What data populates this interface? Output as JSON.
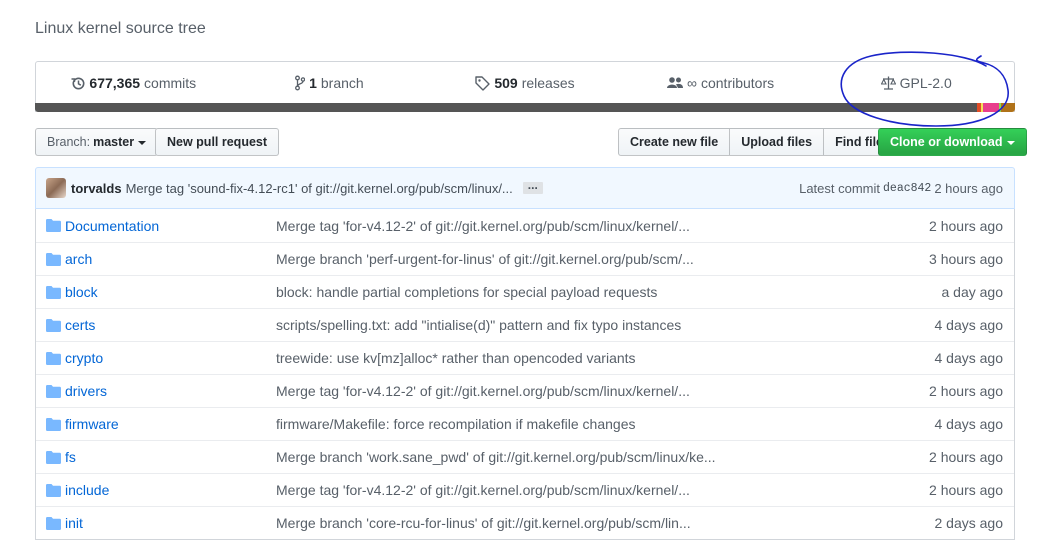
{
  "repo": {
    "description": "Linux kernel source tree"
  },
  "summary": {
    "commits": {
      "icon": "history-icon",
      "count": "677,365",
      "label": "commits"
    },
    "branch": {
      "icon": "git-branch-icon",
      "count": "1",
      "label": "branch"
    },
    "releases": {
      "icon": "tag-icon",
      "count": "509",
      "label": "releases"
    },
    "contributors": {
      "icon": "people-icon",
      "count": "∞",
      "label": "contributors"
    },
    "license": {
      "icon": "law-icon",
      "label": "GPL-2.0"
    }
  },
  "language_bar": [
    {
      "color": "#555555",
      "share": 0.961
    },
    {
      "color": "#e34c26",
      "share": 0.004
    },
    {
      "color": "#f1e05a",
      "share": 0.002
    },
    {
      "color": "#e83e8c",
      "share": 0.017
    },
    {
      "color": "#89e051",
      "share": 0.002
    },
    {
      "color": "#b07219",
      "share": 0.014
    }
  ],
  "toolbar": {
    "branch_prefix": "Branch:",
    "branch_name": "master",
    "new_pr": "New pull request",
    "create_file": "Create new file",
    "upload_files": "Upload files",
    "find_file": "Find file",
    "clone": "Clone or download"
  },
  "latest_commit": {
    "author": "torvalds",
    "message": "Merge tag 'sound-fix-4.12-rc1' of git://git.kernel.org/pub/scm/linux/...",
    "ellipsis": "...",
    "label": "Latest commit",
    "sha": "deac842",
    "age": "2 hours ago"
  },
  "files": [
    {
      "name": "Documentation",
      "message": "Merge tag 'for-v4.12-2' of git://git.kernel.org/pub/scm/linux/kernel/...",
      "age": "2 hours ago"
    },
    {
      "name": "arch",
      "message": "Merge branch 'perf-urgent-for-linus' of git://git.kernel.org/pub/scm/...",
      "age": "3 hours ago"
    },
    {
      "name": "block",
      "message": "block: handle partial completions for special payload requests",
      "age": "a day ago"
    },
    {
      "name": "certs",
      "message": "scripts/spelling.txt: add \"intialise(d)\" pattern and fix typo instances",
      "age": "4 days ago"
    },
    {
      "name": "crypto",
      "message": "treewide: use kv[mz]alloc* rather than opencoded variants",
      "age": "4 days ago"
    },
    {
      "name": "drivers",
      "message": "Merge tag 'for-v4.12-2' of git://git.kernel.org/pub/scm/linux/kernel/...",
      "age": "2 hours ago"
    },
    {
      "name": "firmware",
      "message": "firmware/Makefile: force recompilation if makefile changes",
      "age": "4 days ago"
    },
    {
      "name": "fs",
      "message": "Merge branch 'work.sane_pwd' of git://git.kernel.org/pub/scm/linux/ke...",
      "age": "2 hours ago"
    },
    {
      "name": "include",
      "message": "Merge tag 'for-v4.12-2' of git://git.kernel.org/pub/scm/linux/kernel/...",
      "age": "2 hours ago"
    },
    {
      "name": "init",
      "message": "Merge branch 'core-rcu-for-linus' of git://git.kernel.org/pub/scm/lin...",
      "age": "2 days ago"
    }
  ]
}
